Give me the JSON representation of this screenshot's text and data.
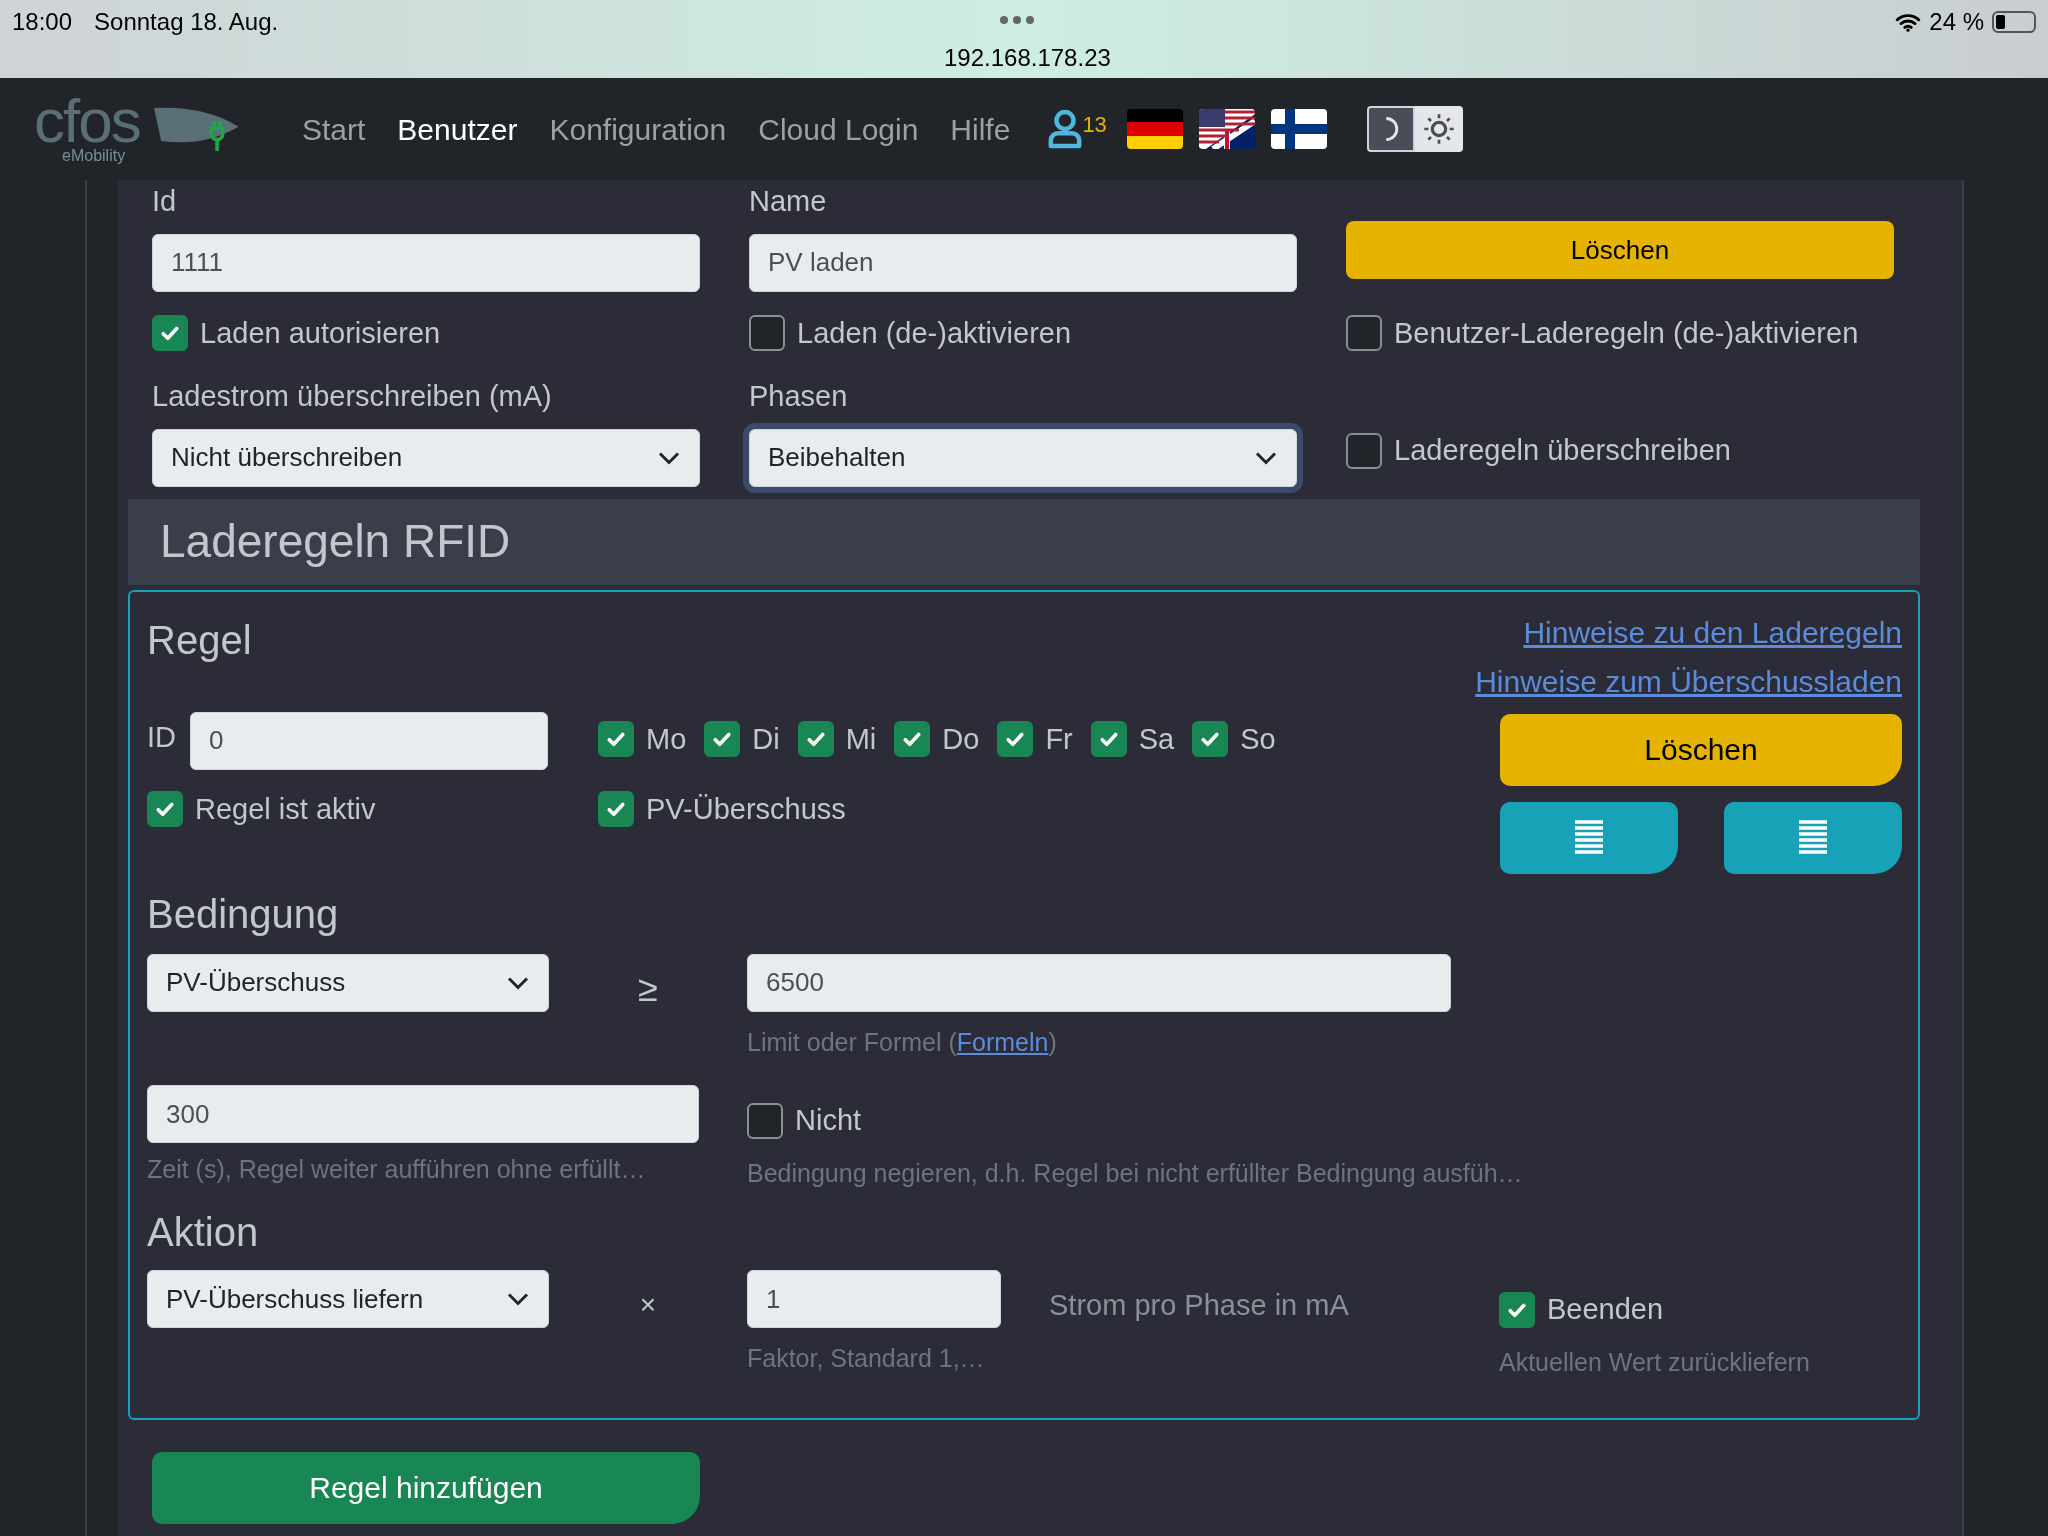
{
  "status_bar": {
    "time": "18:00",
    "date": "Sonntag 18. Aug.",
    "url": "192.168.178.23",
    "battery": "24 %"
  },
  "nav": {
    "logo": "cfos",
    "logo_sub": "eMobility",
    "items": [
      {
        "label": "Start",
        "selected": false
      },
      {
        "label": "Benutzer",
        "selected": true
      },
      {
        "label": "Konfiguration",
        "selected": false
      },
      {
        "label": "Cloud Login",
        "selected": false
      },
      {
        "label": "Hilfe",
        "selected": false
      }
    ],
    "user_count": "13",
    "theme": [
      {
        "kind": "dark",
        "selected": true
      },
      {
        "kind": "light",
        "selected": false
      }
    ]
  },
  "user_form": {
    "id": {
      "label": "Id",
      "value": "1111"
    },
    "name": {
      "label": "Name",
      "value": "PV laden"
    },
    "delete_button": "Löschen",
    "checkboxes": [
      {
        "label": "Laden autorisieren",
        "checked": true
      },
      {
        "label": "Laden (de-)aktivieren",
        "checked": false
      },
      {
        "label": "Benutzer-Laderegeln (de-)aktivieren",
        "checked": false
      }
    ],
    "current_override": {
      "label": "Ladestrom überschreiben (mA)",
      "value": "Nicht überschreiben",
      "focused": false
    },
    "phases": {
      "label": "Phasen",
      "value": "Beibehalten",
      "focused": true
    },
    "override_rules": {
      "label": "Laderegeln überschreiben",
      "checked": false
    }
  },
  "section_title": "Laderegeln RFID",
  "rule": {
    "title": "Regel",
    "links": [
      "Hinweise zu den Laderegeln",
      "Hinweise zum Überschussladen"
    ],
    "id_label": "ID",
    "id_value": "0",
    "days": [
      {
        "label": "Mo",
        "checked": true
      },
      {
        "label": "Di",
        "checked": true
      },
      {
        "label": "Mi",
        "checked": true
      },
      {
        "label": "Do",
        "checked": true
      },
      {
        "label": "Fr",
        "checked": true
      },
      {
        "label": "Sa",
        "checked": true
      },
      {
        "label": "So",
        "checked": true
      }
    ],
    "active": {
      "label": "Regel ist aktiv",
      "checked": true
    },
    "pv_surplus": {
      "label": "PV-Überschuss",
      "checked": true
    },
    "delete_button": "Löschen",
    "condition": {
      "title": "Bedingung",
      "select": "PV-Überschuss",
      "operator": "≥",
      "value": "6500",
      "hint_before": "Limit oder Formel (",
      "hint_link": "Formeln",
      "hint_after": ")",
      "time_value": "300",
      "time_hint": "Zeit (s), Regel weiter aufführen ohne erfüllt…",
      "negate": {
        "label": "Nicht",
        "checked": false
      },
      "negate_hint": "Bedingung negieren, d.h. Regel bei nicht erfüllter Bedingung ausfüh…"
    },
    "action": {
      "title": "Aktion",
      "select": "PV-Überschuss liefern",
      "operator": "×",
      "factor": "1",
      "factor_hint": "Faktor, Standard 1,…",
      "unit": "Strom pro Phase in mA",
      "end": {
        "label": "Beenden",
        "checked": true
      },
      "end_hint": "Aktuellen Wert zurückliefern"
    }
  },
  "add_button": "Regel hinzufügen"
}
